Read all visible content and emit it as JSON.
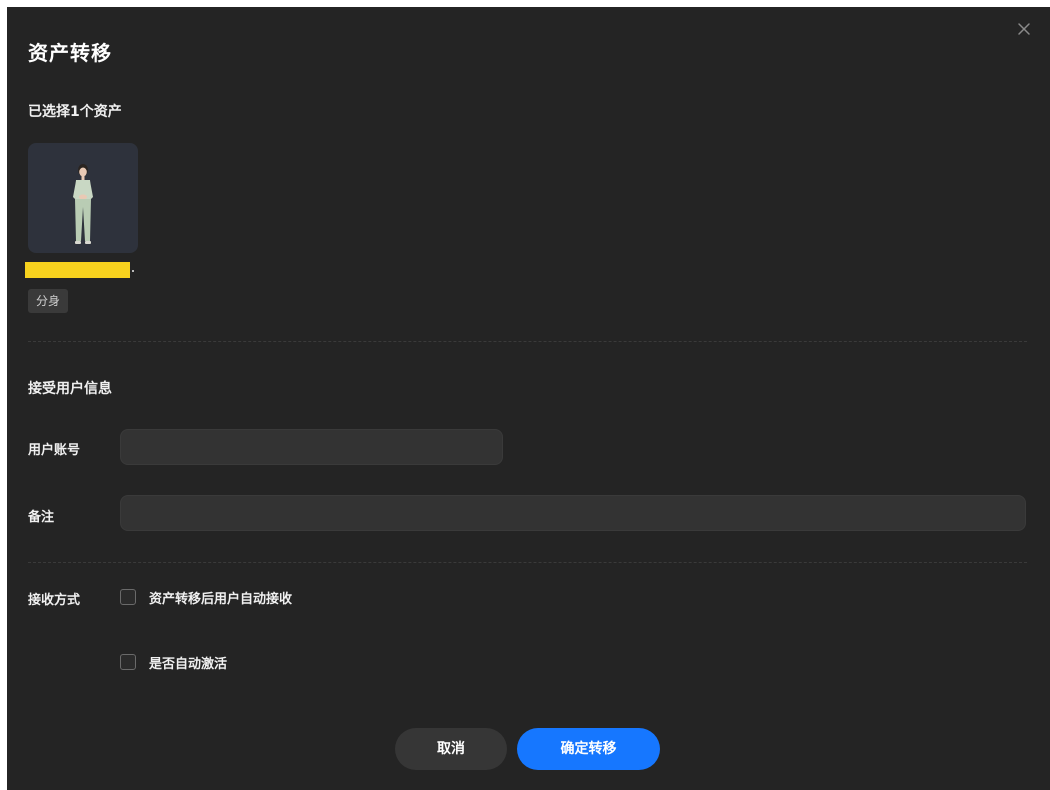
{
  "dialog": {
    "title": "资产转移",
    "close_icon": "close-icon"
  },
  "selection": {
    "label": "已选择1个资产",
    "asset": {
      "tag": "分身",
      "thumbnail_icon": "person-figure"
    }
  },
  "receiver": {
    "section_label": "接受用户信息",
    "account_label": "用户账号",
    "account_value": "",
    "remark_label": "备注",
    "remark_value": ""
  },
  "receive_method": {
    "label": "接收方式",
    "options": [
      {
        "label": "资产转移后用户自动接收",
        "checked": false
      },
      {
        "label": "是否自动激活",
        "checked": false
      }
    ]
  },
  "footer": {
    "cancel_label": "取消",
    "confirm_label": "确定转移"
  },
  "colors": {
    "background": "#242424",
    "accent": "#1677ff",
    "redaction": "#f7d21e"
  }
}
